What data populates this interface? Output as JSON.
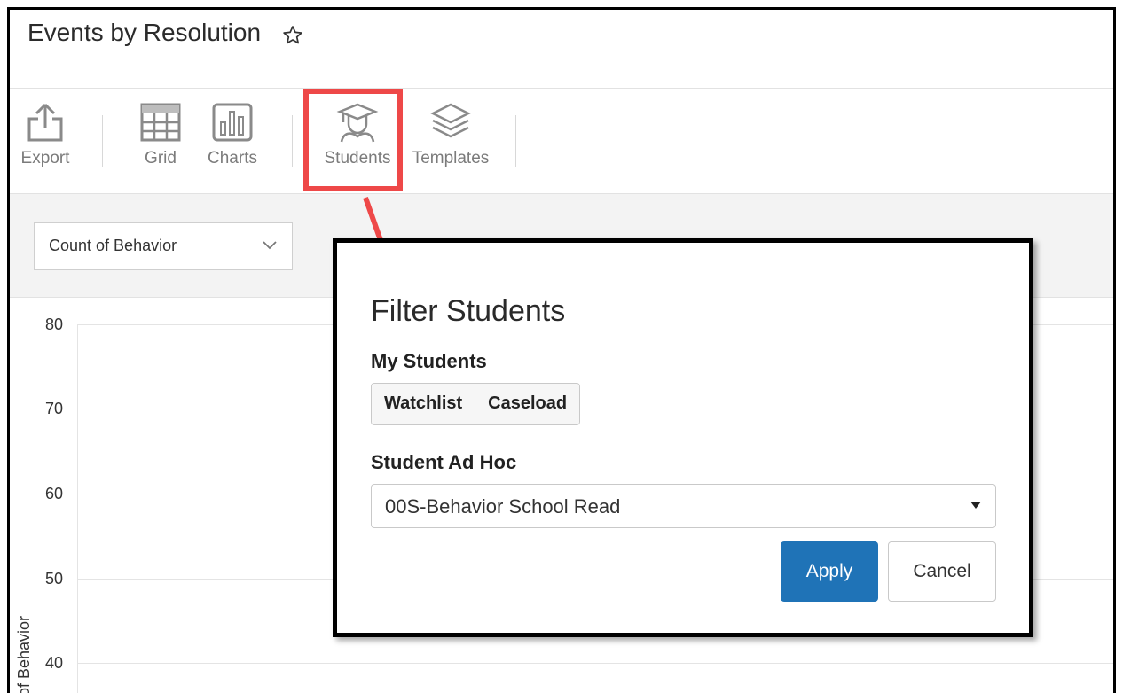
{
  "header": {
    "title": "Events by Resolution"
  },
  "toolbar": {
    "export": "Export",
    "grid": "Grid",
    "charts": "Charts",
    "students": "Students",
    "templates": "Templates"
  },
  "measure_select": {
    "value": "Count of Behavior"
  },
  "chart": {
    "y_ticks": [
      "80",
      "70",
      "60",
      "50",
      "40"
    ],
    "y_label": "t of Behavior"
  },
  "modal": {
    "title": "Filter Students",
    "my_students_label": "My Students",
    "watchlist": "Watchlist",
    "caseload": "Caseload",
    "adhoc_label": "Student Ad Hoc",
    "adhoc_value": "00S-Behavior School Read",
    "apply": "Apply",
    "cancel": "Cancel"
  },
  "colors": {
    "highlight": "#ee4848",
    "primary": "#1f73b7"
  },
  "icons": [
    "star-icon",
    "export-icon",
    "grid-icon",
    "charts-icon",
    "students-icon",
    "templates-icon",
    "chevron-down-icon",
    "caret-down-icon",
    "arrow-icon"
  ]
}
